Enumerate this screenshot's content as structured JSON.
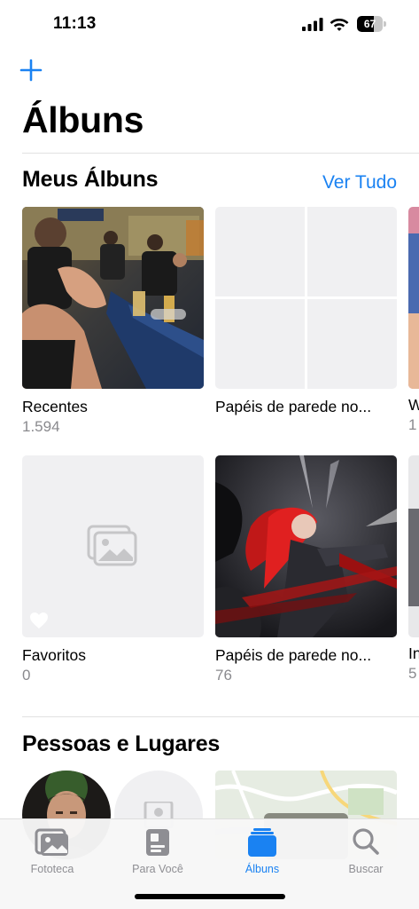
{
  "status_bar": {
    "time": "11:13",
    "battery": "67",
    "battery_level": 0.67
  },
  "header": {
    "title": "Álbuns",
    "add_icon": "plus-icon"
  },
  "my_albums": {
    "title": "Meus Álbuns",
    "see_all": "Ver Tudo",
    "albums": [
      {
        "name": "Recentes",
        "count": "1.594"
      },
      {
        "name": "Papéis de parede no...",
        "count": ""
      },
      {
        "name": "Favoritos",
        "count": "0"
      },
      {
        "name": "Papéis de parede no...",
        "count": "76"
      }
    ],
    "partial_albums": [
      {
        "name": "W",
        "count": "1"
      },
      {
        "name": "In",
        "count": "5"
      }
    ]
  },
  "people_places": {
    "title": "Pessoas e Lugares"
  },
  "tab_bar": {
    "tabs": [
      {
        "label": "Fototeca",
        "icon": "photo-library-icon"
      },
      {
        "label": "Para Você",
        "icon": "for-you-icon"
      },
      {
        "label": "Álbuns",
        "icon": "albums-icon"
      },
      {
        "label": "Buscar",
        "icon": "search-icon"
      }
    ],
    "active": "Álbuns"
  },
  "colors": {
    "accent": "#1a82f2",
    "secondary_text": "#8a8a8e",
    "placeholder": "#f0f0f2"
  }
}
